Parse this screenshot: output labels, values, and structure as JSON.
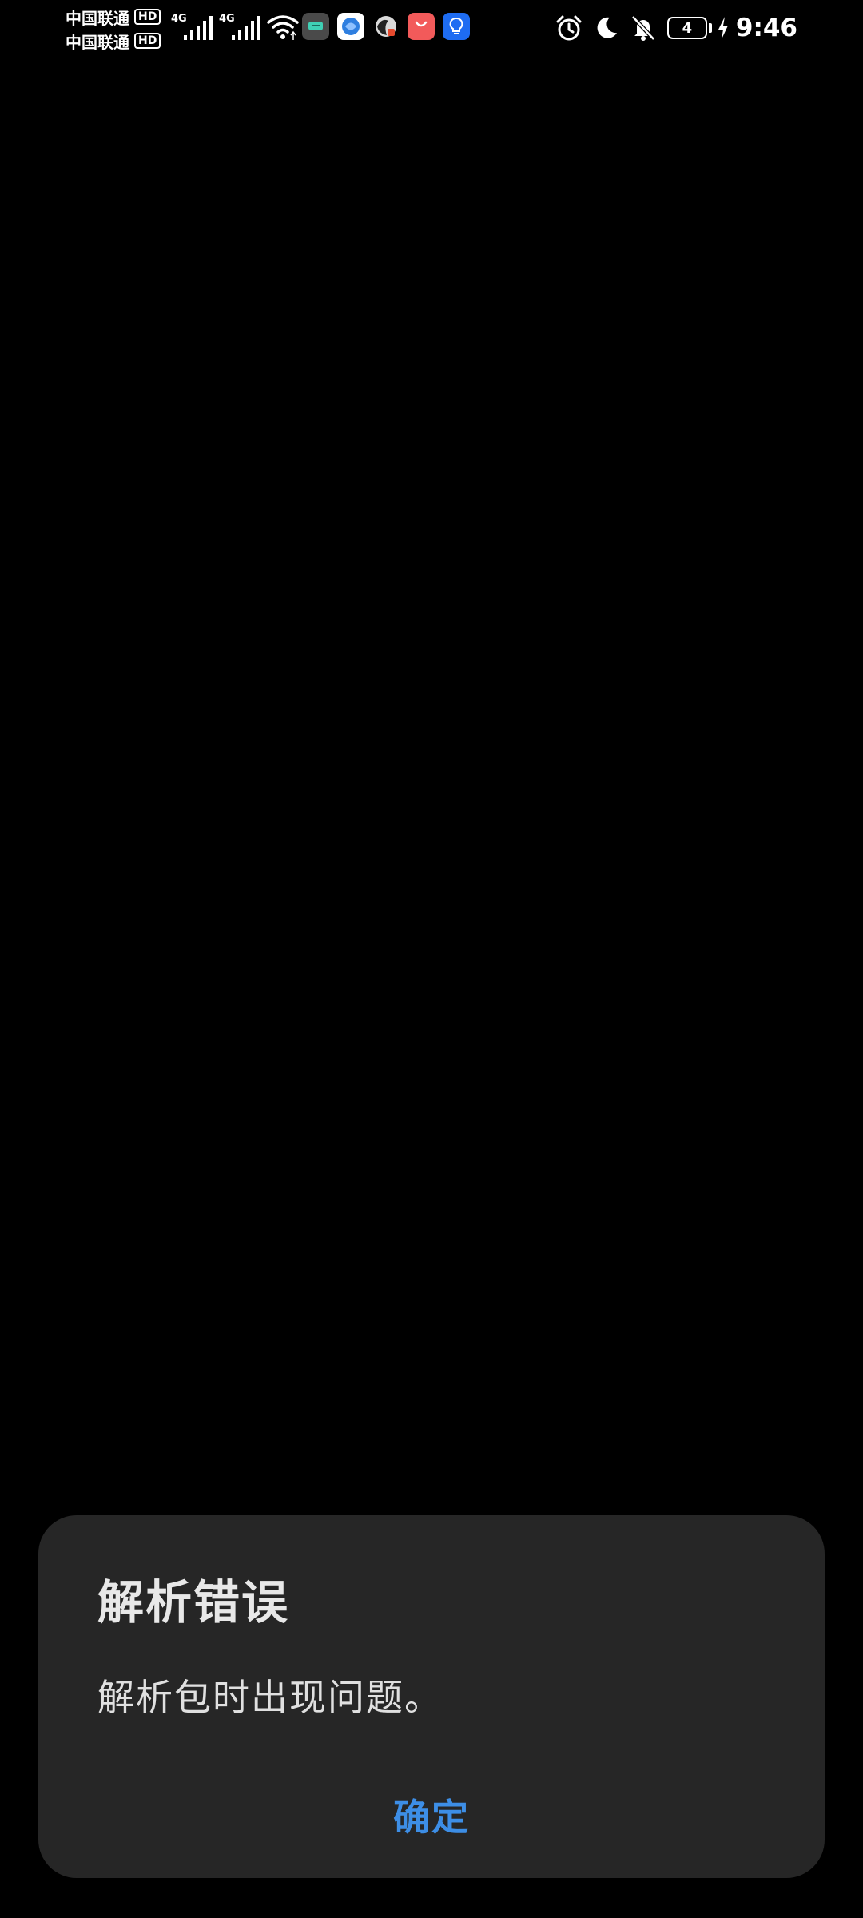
{
  "status_bar": {
    "carriers": [
      {
        "name": "中国联通",
        "badge": "HD"
      },
      {
        "name": "中国联通",
        "badge": "HD"
      }
    ],
    "network_type_1": "4G",
    "network_type_2": "4G",
    "battery_level": "4",
    "time": "9:46",
    "icons": [
      "signal-icon",
      "signal-icon",
      "wifi-icon",
      "app-notification-icons",
      "alarm-icon",
      "moon-icon",
      "bell-off-icon",
      "battery-icon",
      "charging-icon"
    ]
  },
  "dialog": {
    "title": "解析错误",
    "message": "解析包时出现问题。",
    "confirm_label": "确定"
  },
  "colors": {
    "background": "#000000",
    "dialog_bg": "#262626",
    "accent": "#3d8ee6",
    "text": "#e8e8e8"
  }
}
